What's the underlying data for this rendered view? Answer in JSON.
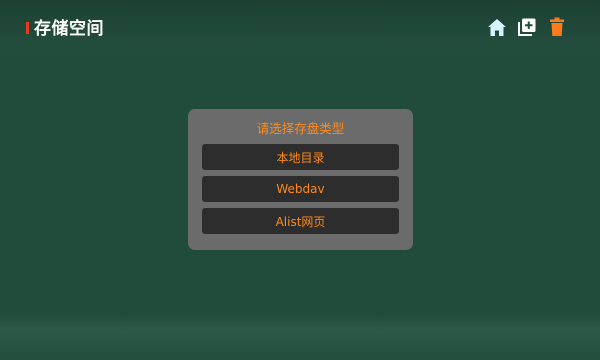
{
  "header": {
    "title": "存储空间",
    "accent_color": "#e63a21",
    "icons": [
      "home-icon",
      "add-icon",
      "trash-icon"
    ]
  },
  "dialog": {
    "title": "请选择存盘类型",
    "options": [
      {
        "label": "本地目录"
      },
      {
        "label": "Webdav"
      },
      {
        "label": "Alist网页"
      }
    ],
    "text_color": "#ff8a1a",
    "background": "#6b6b6b"
  }
}
